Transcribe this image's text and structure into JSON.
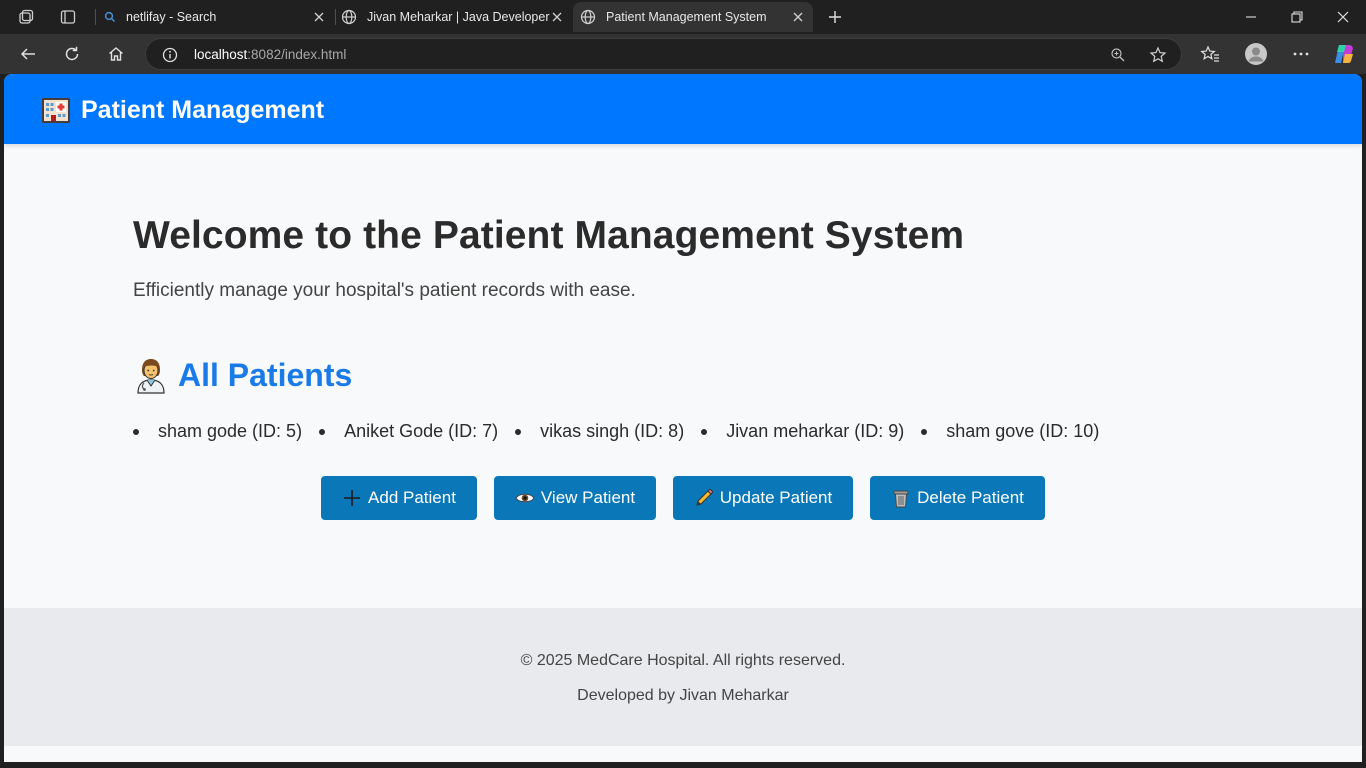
{
  "browser": {
    "tabs": [
      {
        "label": "netlifay - Search",
        "active": false
      },
      {
        "label": "Jivan Meharkar | Java Developer",
        "active": false
      },
      {
        "label": "Patient Management System",
        "active": true
      }
    ],
    "address": {
      "host": "localhost",
      "rest": ":8082/index.html"
    },
    "accent": "#0077ff"
  },
  "header": {
    "brand": "Patient Management"
  },
  "main": {
    "title": "Welcome to the Patient Management System",
    "subtitle": "Efficiently manage your hospital's patient records with ease."
  },
  "patients": {
    "heading": "All Patients",
    "items": [
      "sham gode (ID: 5)",
      "Aniket Gode (ID: 7)",
      "vikas singh (ID: 8)",
      "Jivan meharkar (ID: 9)",
      "sham gove (ID: 10)"
    ]
  },
  "actions": {
    "add": "Add Patient",
    "view": "View Patient",
    "update": "Update Patient",
    "delete": "Delete Patient"
  },
  "footer": {
    "copyright": "© 2025 MedCare Hospital. All rights reserved.",
    "developer": "Developed by Jivan Meharkar"
  }
}
